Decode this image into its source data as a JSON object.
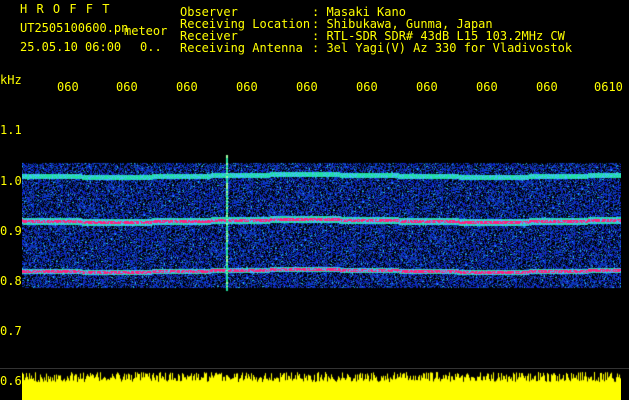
{
  "header": {
    "title": "H R O F F T",
    "filename": "UT2505100600.pn",
    "mode": "meteor",
    "datetime": "25.05.10 06:00",
    "extra": "0..",
    "info_labels": [
      "Observer",
      "Receiving Location",
      "Receiver",
      "Receiving Antenna"
    ],
    "info_values": [
      ": Masaki Kano",
      ": Shibukawa, Gunma, Japan",
      ": RTL-SDR SDR# 43dB L15 103.2MHz CW",
      ": 3el Yagi(V) Az 330 for Vladivostok"
    ]
  },
  "axes": {
    "y_unit": "kHz",
    "x_ticks": [
      "060",
      "060",
      "060",
      "060",
      "060",
      "060",
      "060",
      "060",
      "060",
      "0610"
    ],
    "y_ticks": [
      "1.1",
      "1.0",
      "0.9",
      "0.8",
      "0.7",
      "0.6"
    ]
  },
  "colors": {
    "text": "#ffff00",
    "background": "#000000",
    "noise": "#1030c0",
    "signal_strong": "#ff2080",
    "signal_mid": "#20e0a0",
    "baseline": "#ffff00"
  },
  "chart_data": {
    "type": "heatmap",
    "y_unit": "kHz",
    "ylim": [
      0.6,
      1.15
    ],
    "signal_bands_khz": [
      1.0,
      0.91,
      0.81
    ],
    "meteor_echo_x_fraction": 0.34
  }
}
